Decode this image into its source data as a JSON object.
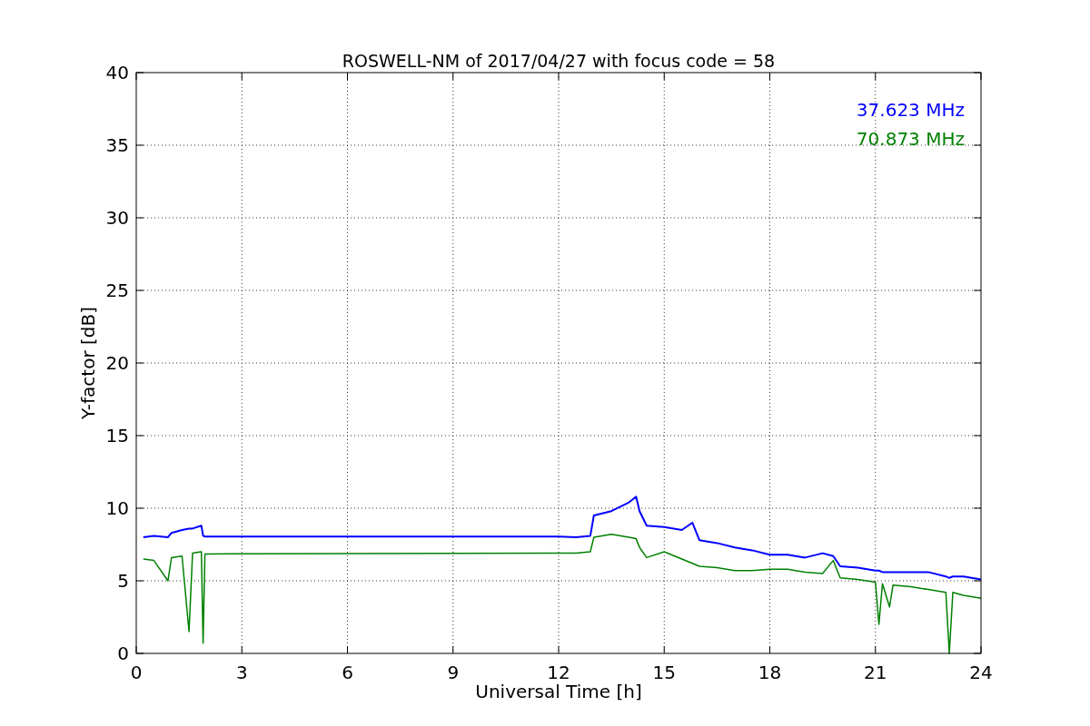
{
  "chart_data": {
    "type": "line",
    "title": "ROSWELL-NM of 2017/04/27 with focus code = 58",
    "xlabel": "Universal Time [h]",
    "ylabel": "Y-factor [dB]",
    "x": [
      0.2,
      0.5,
      0.9,
      1.0,
      1.3,
      1.5,
      1.6,
      1.85,
      1.9,
      1.95,
      12.0,
      12.5,
      12.9,
      13.0,
      13.5,
      14.0,
      14.2,
      14.3,
      14.5,
      15.0,
      15.5,
      15.8,
      16.0,
      16.5,
      17.0,
      17.5,
      18.0,
      18.5,
      19.0,
      19.5,
      19.8,
      20.0,
      20.5,
      21.0,
      21.1,
      21.2,
      21.4,
      21.5,
      22.0,
      22.5,
      23.0,
      23.1,
      23.2,
      23.5,
      24.0
    ],
    "series": [
      {
        "name": "37.623 MHz",
        "color": "#0000ff",
        "values": [
          8.0,
          8.1,
          8.0,
          8.3,
          8.5,
          8.6,
          8.6,
          8.8,
          8.1,
          8.05,
          8.05,
          8.0,
          8.1,
          9.5,
          9.8,
          10.4,
          10.8,
          9.8,
          8.8,
          8.7,
          8.5,
          9.0,
          7.8,
          7.6,
          7.3,
          7.1,
          6.8,
          6.8,
          6.6,
          6.9,
          6.7,
          6.0,
          5.9,
          5.7,
          5.7,
          5.6,
          5.6,
          5.6,
          5.6,
          5.6,
          5.3,
          5.2,
          5.3,
          5.3,
          5.1
        ]
      },
      {
        "name": "70.873 MHz",
        "color": "#008000",
        "values": [
          6.5,
          6.4,
          5.0,
          6.6,
          6.7,
          1.5,
          6.9,
          7.0,
          0.7,
          6.85,
          6.9,
          6.9,
          7.0,
          8.0,
          8.2,
          8.0,
          7.9,
          7.3,
          6.6,
          7.0,
          6.5,
          6.2,
          6.0,
          5.9,
          5.7,
          5.7,
          5.8,
          5.8,
          5.6,
          5.5,
          6.4,
          5.2,
          5.1,
          4.9,
          2.0,
          4.8,
          3.2,
          4.7,
          4.6,
          4.4,
          4.2,
          0.0,
          4.2,
          4.0,
          3.8
        ]
      }
    ],
    "grid": true,
    "xlim": [
      0,
      24
    ],
    "ylim": [
      0,
      40
    ],
    "xticks": [
      0,
      3,
      6,
      9,
      12,
      15,
      18,
      21,
      24
    ],
    "yticks": [
      0,
      5,
      10,
      15,
      20,
      25,
      30,
      35,
      40
    ]
  }
}
